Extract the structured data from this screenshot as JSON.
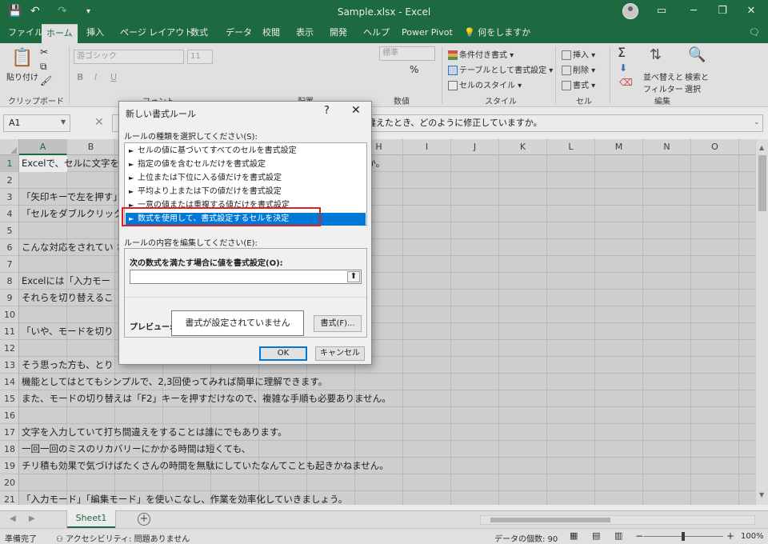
{
  "window": {
    "title": "Sample.xlsx  -  Excel",
    "controls": {
      "minimize": "─",
      "restore": "❐",
      "close": "✕",
      "display_options": "▭"
    }
  },
  "quick_access": {
    "save": "💾",
    "undo": "↶",
    "redo": "↷",
    "customize": "▾"
  },
  "ribbon_tabs": [
    {
      "label": "ファイル"
    },
    {
      "label": "ホーム"
    },
    {
      "label": "挿入"
    },
    {
      "label": "ページ レイアウト"
    },
    {
      "label": "数式"
    },
    {
      "label": "データ"
    },
    {
      "label": "校閲"
    },
    {
      "label": "表示"
    },
    {
      "label": "開発"
    },
    {
      "label": "ヘルプ"
    },
    {
      "label": "Power Pivot"
    },
    {
      "label": "何をしますか"
    }
  ],
  "ribbon": {
    "clipboard": {
      "paste": "貼り付け",
      "group": "クリップボード"
    },
    "font": {
      "name": "游ゴシック",
      "size": "11",
      "bold": "B",
      "italic": "I",
      "underline": "U",
      "group": "フォント"
    },
    "alignment": {
      "group": "配置"
    },
    "number": {
      "format": "標準",
      "percent": "%",
      "group": "数値"
    },
    "styles": {
      "conditional": "条件付き書式",
      "table": "テーブルとして書式設定",
      "cell_styles": "セルのスタイル",
      "group": "スタイル"
    },
    "cells": {
      "insert": "挿入",
      "delete": "削除",
      "format": "書式",
      "group": "セル"
    },
    "editing": {
      "sum": "Σ",
      "sort": "並べ替えと",
      "sort2": "フィルター",
      "find": "検索と",
      "find2": "選択",
      "group": "編集"
    }
  },
  "formula_bar": {
    "name_box": "A1",
    "content": "違えたとき、どのように修正していますか。"
  },
  "columns": [
    "A",
    "B",
    "C",
    "D",
    "E",
    "F",
    "G",
    "H",
    "I",
    "J",
    "K",
    "L",
    "M",
    "N",
    "O"
  ],
  "rows": [
    {
      "num": "1",
      "text": "Excelで、セルに文字を入力する時、打ち間違えたとき、どのように修正していますか。"
    },
    {
      "num": "2",
      "text": ""
    },
    {
      "num": "3",
      "text": "「矢印キーで左を押す」と、どこに移動していいます」"
    },
    {
      "num": "4",
      "text": "「セルをダブルクリック"
    },
    {
      "num": "5",
      "text": ""
    },
    {
      "num": "6",
      "text": "こんな対応をされてい                                             さい。"
    },
    {
      "num": "7",
      "text": ""
    },
    {
      "num": "8",
      "text": "Excelには「入力モー"
    },
    {
      "num": "9",
      "text": "それらを切り替えるこ"
    },
    {
      "num": "10",
      "text": ""
    },
    {
      "num": "11",
      "text": "「いや、モードを切り"
    },
    {
      "num": "12",
      "text": ""
    },
    {
      "num": "13",
      "text": "そう思った方も、とり"
    },
    {
      "num": "14",
      "text": "機能としてはとてもシンプルで、2,3回使ってみれば簡単に理解できます。"
    },
    {
      "num": "15",
      "text": "また、モードの切り替えは「F2」キーを押すだけなので、複雑な手順も必要ありません。"
    },
    {
      "num": "16",
      "text": ""
    },
    {
      "num": "17",
      "text": "文字を入力していて打ち間違えをすることは誰にでもあります。"
    },
    {
      "num": "18",
      "text": "一回一回のミスのリカバリーにかかる時間は短くても、"
    },
    {
      "num": "19",
      "text": "チリ積も効果で気づけばたくさんの時間を無駄にしていたなんてことも起きかねません。"
    },
    {
      "num": "20",
      "text": ""
    },
    {
      "num": "21",
      "text": "「入力モード」「編集モード」を使いこなし、作業を効率化していきましょう。"
    }
  ],
  "sheet_tabs": {
    "active": "Sheet1",
    "add": "+"
  },
  "status": {
    "ready": "準備完了",
    "accessibility": "アクセシビリティ: 問題ありません",
    "count": "データの個数: 90",
    "zoom": "100%",
    "zoom_minus": "−",
    "zoom_plus": "+"
  },
  "dialog": {
    "title": "新しい書式ルール",
    "help": "?",
    "close": "✕",
    "rule_type_label": "ルールの種類を選択してください(S):",
    "rule_types": [
      {
        "label": "セルの値に基づいてすべてのセルを書式設定"
      },
      {
        "label": "指定の値を含むセルだけを書式設定"
      },
      {
        "label": "上位または下位に入る値だけを書式設定"
      },
      {
        "label": "平均より上または下の値だけを書式設定"
      },
      {
        "label": "一意の値または重複する値だけを書式設定"
      },
      {
        "label": "数式を使用して、書式設定するセルを決定"
      }
    ],
    "selected_index": 5,
    "edit_label": "ルールの内容を編集してください(E):",
    "formula_label": "次の数式を満たす場合に値を書式設定(O):",
    "formula_value": "",
    "preview_label": "プレビュー:",
    "preview_text": "書式が設定されていません",
    "format_button": "書式(F)...",
    "ok": "OK",
    "cancel": "キャンセル"
  },
  "colors": {
    "excel_green": "#217346",
    "selection_blue": "#0078d7",
    "highlight_red": "#e02020"
  }
}
